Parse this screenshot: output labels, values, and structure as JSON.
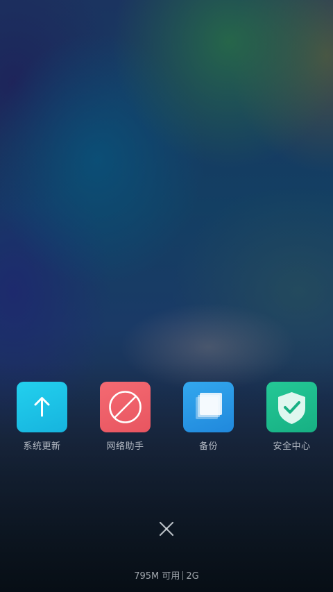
{
  "quick_toggles": [
    {
      "label": "系统更新",
      "icon": "arrow-up-icon",
      "color": "#1cc4e8"
    },
    {
      "label": "网络助手",
      "icon": "block-icon",
      "color": "#f0606a"
    },
    {
      "label": "备份",
      "icon": "backup-layers-icon",
      "color": "#2a9ae6"
    },
    {
      "label": "安全中心",
      "icon": "shield-check-icon",
      "color": "#1fbf8c"
    }
  ],
  "close": {
    "icon": "close-icon"
  },
  "memory": {
    "available": "795M 可用",
    "total": "2G"
  }
}
